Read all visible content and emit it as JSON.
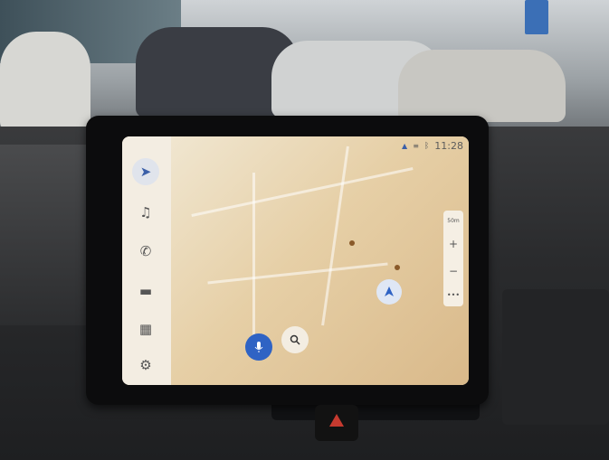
{
  "status_bar": {
    "time": "11:28"
  },
  "rail": {
    "items": [
      {
        "icon": "navigation-icon",
        "glyph": "➤",
        "active": true
      },
      {
        "icon": "music-icon",
        "glyph": "♫",
        "active": false
      },
      {
        "icon": "phone-icon",
        "glyph": "✆",
        "active": false
      },
      {
        "icon": "car-icon",
        "glyph": "▬",
        "active": false
      },
      {
        "icon": "apps-grid-icon",
        "glyph": "▦",
        "active": false
      },
      {
        "icon": "settings-icon",
        "glyph": "⚙",
        "active": false
      }
    ]
  },
  "map": {
    "scale_label": "50m",
    "zoom_in": "+",
    "zoom_out": "−",
    "more": "•••"
  },
  "bottom": {
    "mic_icon": "microphone-icon",
    "search_icon": "search-icon"
  },
  "colors": {
    "accent": "#2f63c4",
    "map_bg": "#e6cfa6"
  }
}
